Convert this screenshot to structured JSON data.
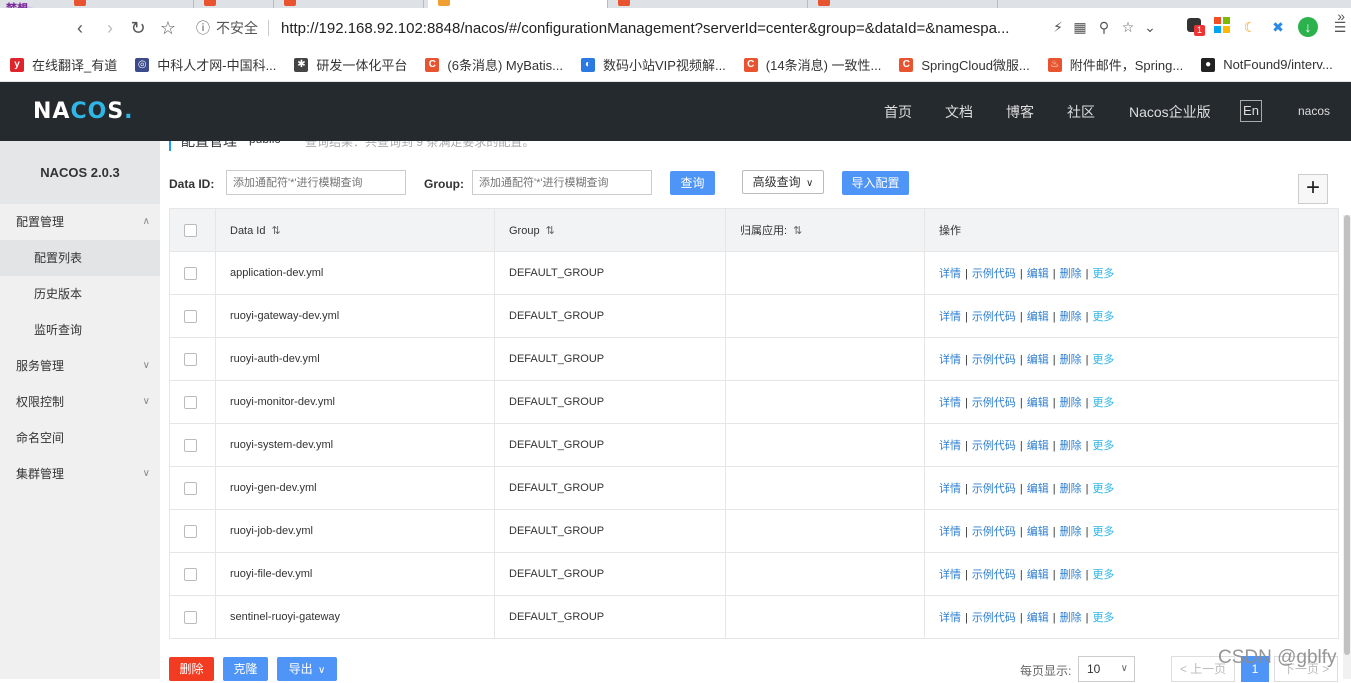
{
  "browser": {
    "security_label": "不安全",
    "url": "http://192.168.92.102:8848/nacos/#/configurationManagement?serverId=center&group=&dataId=&namespa...",
    "bookmarks": [
      {
        "label": "在线翻译_有道",
        "icon": "youdao-icon",
        "color": "#e0242b"
      },
      {
        "label": "中科人才网-中国科...",
        "icon": "globe-icon",
        "color": "#3a4a8a"
      },
      {
        "label": "研发一体化平台",
        "icon": "gear-icon",
        "color": "#444444"
      },
      {
        "label": "(6条消息) MyBatis...",
        "icon": "csdn-icon",
        "color": "#e8542f"
      },
      {
        "label": "数码小站VIP视频解...",
        "icon": "video-icon",
        "color": "#2a7ae2"
      },
      {
        "label": "(14条消息) 一致性...",
        "icon": "csdn-icon",
        "color": "#e8542f"
      },
      {
        "label": "SpringCloud微服...",
        "icon": "csdn-icon",
        "color": "#e8542f"
      },
      {
        "label": "附件邮件，Spring...",
        "icon": "flame-icon",
        "color": "#e8542f"
      },
      {
        "label": "NotFound9/interv...",
        "icon": "github-icon",
        "color": "#222222"
      }
    ],
    "notification_badge": "1"
  },
  "header": {
    "logo": "NACOS.",
    "nav": [
      "首页",
      "文档",
      "博客",
      "社区",
      "Nacos企业版"
    ],
    "lang": "En",
    "user": "nacos"
  },
  "sidebar": {
    "title": "NACOS 2.0.3",
    "items": [
      {
        "label": "配置管理",
        "level": 1,
        "expanded": true
      },
      {
        "label": "配置列表",
        "level": 2,
        "selected": true
      },
      {
        "label": "历史版本",
        "level": 2
      },
      {
        "label": "监听查询",
        "level": 2
      },
      {
        "label": "服务管理",
        "level": 1,
        "expanded": false
      },
      {
        "label": "权限控制",
        "level": 1,
        "expanded": false
      },
      {
        "label": "命名空间",
        "level": 1
      },
      {
        "label": "集群管理",
        "level": 1,
        "expanded": false
      }
    ]
  },
  "breadcrumb": {
    "title": "配置管理",
    "namespace": "public",
    "hint": "查询结果：共查询到 9 条满足要求的配置。"
  },
  "filters": {
    "data_id_label": "Data ID:",
    "data_id_placeholder": "添加通配符'*'进行模糊查询",
    "group_label": "Group:",
    "group_placeholder": "添加通配符'*'进行模糊查询",
    "search_button": "查询",
    "advanced_button": "高级查询",
    "import_button": "导入配置"
  },
  "table": {
    "headers": [
      "Data Id",
      "Group",
      "归属应用:",
      "操作"
    ],
    "rows": [
      {
        "data_id": "application-dev.yml",
        "group": "DEFAULT_GROUP",
        "app": ""
      },
      {
        "data_id": "ruoyi-gateway-dev.yml",
        "group": "DEFAULT_GROUP",
        "app": ""
      },
      {
        "data_id": "ruoyi-auth-dev.yml",
        "group": "DEFAULT_GROUP",
        "app": ""
      },
      {
        "data_id": "ruoyi-monitor-dev.yml",
        "group": "DEFAULT_GROUP",
        "app": ""
      },
      {
        "data_id": "ruoyi-system-dev.yml",
        "group": "DEFAULT_GROUP",
        "app": ""
      },
      {
        "data_id": "ruoyi-gen-dev.yml",
        "group": "DEFAULT_GROUP",
        "app": ""
      },
      {
        "data_id": "ruoyi-job-dev.yml",
        "group": "DEFAULT_GROUP",
        "app": ""
      },
      {
        "data_id": "ruoyi-file-dev.yml",
        "group": "DEFAULT_GROUP",
        "app": ""
      },
      {
        "data_id": "sentinel-ruoyi-gateway",
        "group": "DEFAULT_GROUP",
        "app": ""
      }
    ],
    "actions": {
      "detail": "详情",
      "sample": "示例代码",
      "edit": "编辑",
      "delete": "删除",
      "more": "更多",
      "sep": "|"
    }
  },
  "footer": {
    "delete_button": "删除",
    "clone_button": "克隆",
    "export_button": "导出",
    "page_size_label": "每页显示:",
    "page_size": "10",
    "prev": "< 上一页",
    "current_page": "1",
    "next": "下一页 >"
  },
  "watermark": "CSDN @gblfy",
  "colors": {
    "header_bg": "#252a2f",
    "primary": "#4f95f7",
    "danger": "#f23c22",
    "link": "#2f7fd0"
  }
}
